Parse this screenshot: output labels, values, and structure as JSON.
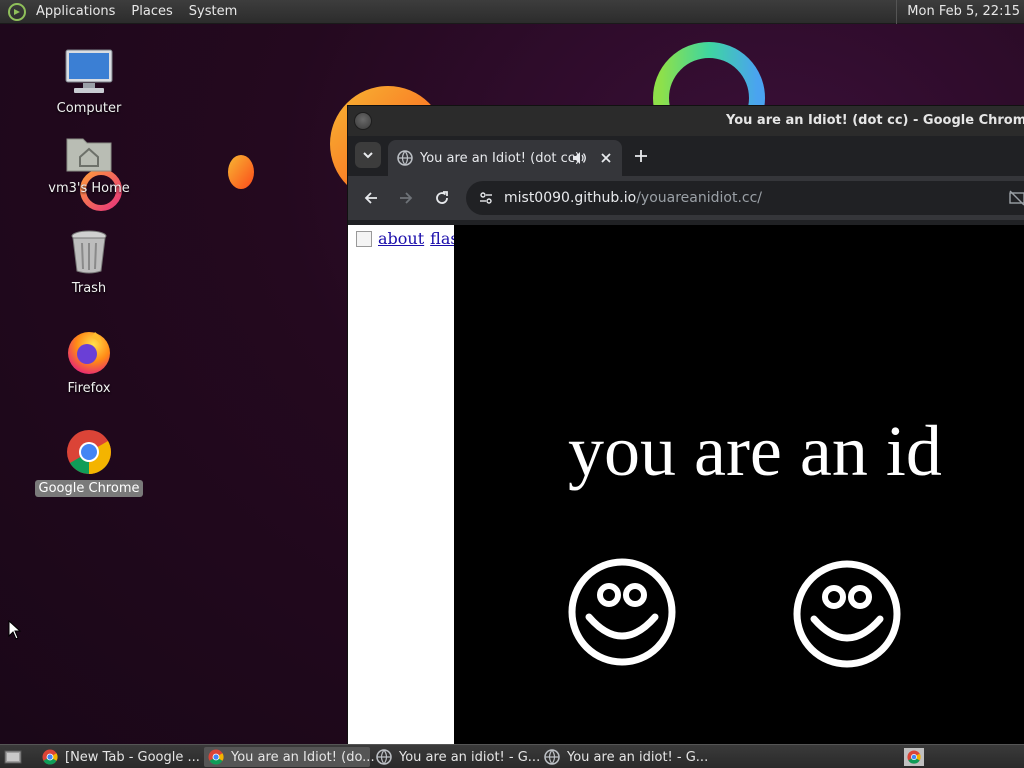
{
  "top_panel": {
    "menus": [
      "Applications",
      "Places",
      "System"
    ],
    "clock": "Mon Feb  5, 22:15"
  },
  "desktop": {
    "icons": [
      {
        "label": "Computer",
        "icon": "computer-icon"
      },
      {
        "label": "vm3's Home",
        "icon": "home-folder-icon"
      },
      {
        "label": "Trash",
        "icon": "trash-icon"
      },
      {
        "label": "Firefox",
        "icon": "firefox-icon"
      },
      {
        "label": "Google Chrome",
        "icon": "chrome-icon",
        "selected": true
      }
    ]
  },
  "chrome_window": {
    "title": "You are an Idiot! (dot cc) - Google Chrome",
    "tab": {
      "label": "You are an Idiot! (dot cc)",
      "audio": true
    },
    "url": {
      "host": "mist0090.github.io",
      "path": "/youareanidiot.cc/"
    },
    "page": {
      "left_links": [
        "about",
        "flash"
      ],
      "headline": "you are an id"
    }
  },
  "taskbar": {
    "tasks": [
      {
        "label": "[New Tab - Google ...",
        "icon": "chrome-icon",
        "active": false
      },
      {
        "label": "You are an Idiot! (do...",
        "icon": "chrome-icon",
        "active": true
      },
      {
        "label": "You are an idiot! - G...",
        "icon": "globe-icon",
        "active": false
      },
      {
        "label": "You are an idiot! - G...",
        "icon": "globe-icon",
        "active": false
      }
    ]
  },
  "colors": {
    "wallpaper": "#24091f",
    "panel": "#2c2c2c",
    "chrome_frame": "#202124",
    "chrome_toolbar": "#35363a"
  }
}
